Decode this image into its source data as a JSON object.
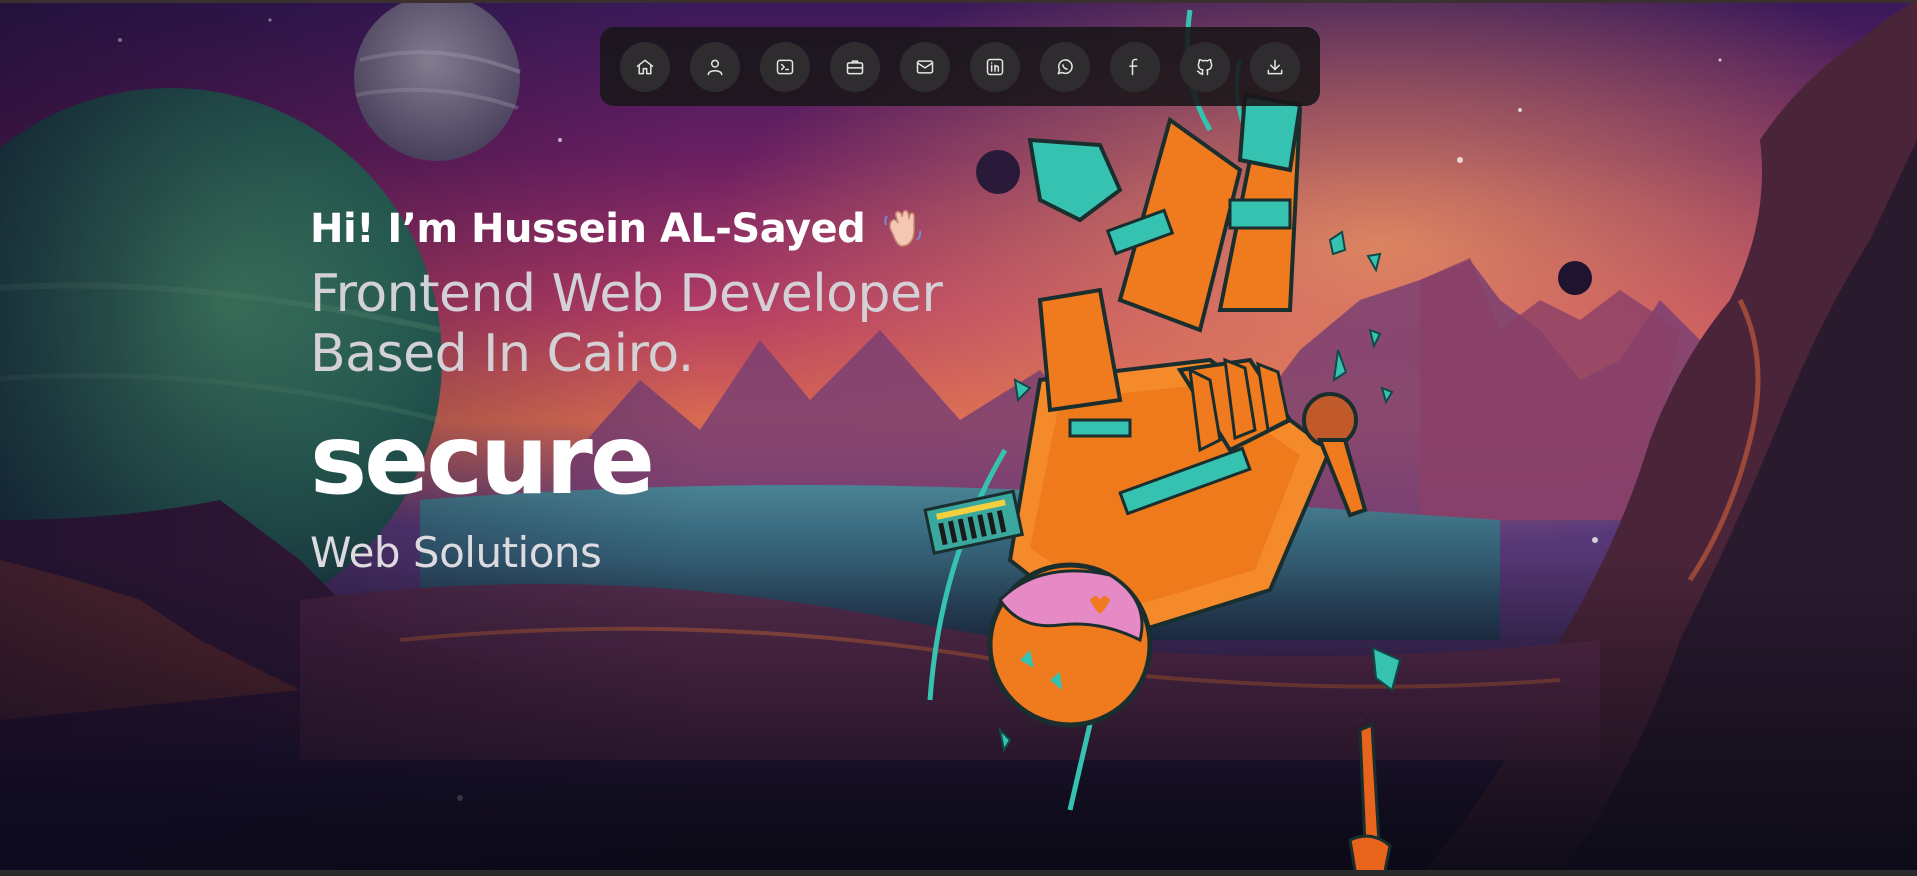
{
  "nav": {
    "items": [
      {
        "icon": "home-icon",
        "label": "Home"
      },
      {
        "icon": "user-icon",
        "label": "About"
      },
      {
        "icon": "terminal-icon",
        "label": "Skills"
      },
      {
        "icon": "briefcase-icon",
        "label": "Projects"
      },
      {
        "icon": "mail-icon",
        "label": "Email"
      },
      {
        "icon": "linkedin-icon",
        "label": "LinkedIn"
      },
      {
        "icon": "whatsapp-icon",
        "label": "WhatsApp"
      },
      {
        "icon": "facebook-icon",
        "label": "Facebook"
      },
      {
        "icon": "github-icon",
        "label": "GitHub"
      },
      {
        "icon": "download-icon",
        "label": "Download"
      }
    ]
  },
  "hero": {
    "greeting": "Hi! I’m Hussein AL-Sayed",
    "greeting_emoji": "waving-hand-icon",
    "headline_line1": "Frontend Web Developer",
    "headline_line2": "Based In Cairo.",
    "rotating_word": "secure",
    "subline": "Web Solutions"
  },
  "colors": {
    "dock_bg": "#181618",
    "dock_button": "#2e2c2e",
    "icon_stroke": "#e6e6e6",
    "text_primary": "#ffffff",
    "text_secondary": "#d4d1d6",
    "astronaut_orange": "#f07a1e",
    "astronaut_teal": "#2fb7a6"
  }
}
